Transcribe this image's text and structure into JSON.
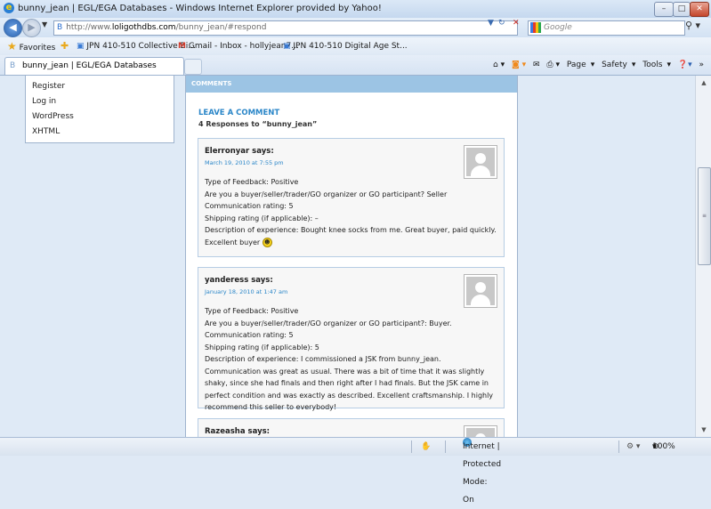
{
  "window": {
    "title": "bunny_jean | EGL/EGA Databases - Windows Internet Explorer provided by Yahoo!",
    "minimize": "–",
    "maximize": "□",
    "close": "✕"
  },
  "address": {
    "url_prefix": "http://www.",
    "url_host": "loligothdbs.com",
    "url_path": "/bunny_jean/#respond",
    "search_placeholder": "Google"
  },
  "favorites": {
    "label": "Favorites",
    "items": [
      "JPN 410-510 Collective Bi...",
      "Gmail - Inbox - hollyjean7...",
      "JPN 410-510 Digital Age St..."
    ]
  },
  "tab": {
    "label": "bunny_jean | EGL/EGA Databases"
  },
  "commandbar": {
    "page": "Page",
    "safety": "Safety",
    "tools": "Tools"
  },
  "sidebar": {
    "items": [
      "Register",
      "Log in",
      "WordPress",
      "XHTML"
    ]
  },
  "main": {
    "header": "COMMENTS",
    "leave_comment": "LEAVE A COMMENT",
    "responses": "4 Responses to “bunny_jean”"
  },
  "comments": [
    {
      "author": "Elerronyar says:",
      "date": "March 19, 2010 at 7:55 pm",
      "lines": [
        "Type of Feedback: Positive",
        "Are you a buyer/seller/trader/GO organizer or GO participant? Seller",
        "Communication rating: 5",
        "Shipping rating (if applicable): –",
        "Description of experience: Bought knee socks from me. Great buyer, paid quickly. Excellent buyer"
      ]
    },
    {
      "author": "yanderess says:",
      "date": "January 18, 2010 at 1:47 am",
      "lines": [
        "Type of Feedback: Positive",
        "Are you a buyer/seller/trader/GO organizer or GO participant?: Buyer.",
        "Communication rating: 5",
        "Shipping rating (if applicable): 5",
        "Description of experience: I commissioned a JSK from bunny_jean. Communication was great as usual. There was a bit of time that it was slightly shaky, since she had finals and then right after I had finals. But the JSK came in perfect condition and was exactly as described. Excellent craftsmanship. I highly recommend this seller to everybody!"
      ]
    },
    {
      "author": "Razeasha says:",
      "date": "",
      "lines": []
    }
  ],
  "status": {
    "zone": "Internet | Protected Mode: On",
    "zoom": "100%"
  }
}
